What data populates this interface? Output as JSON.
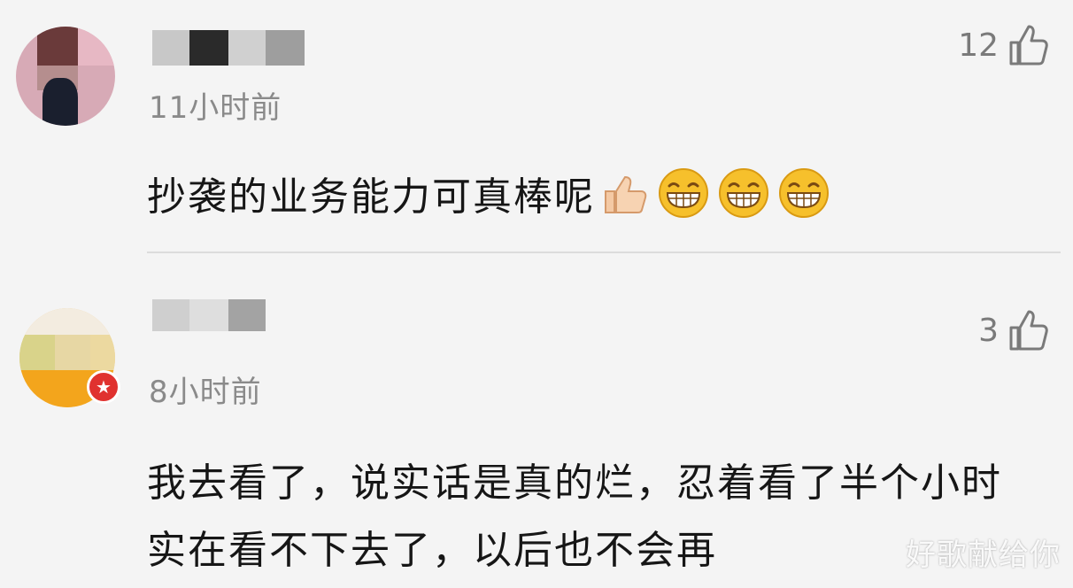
{
  "comments": [
    {
      "time": "11小时前",
      "likes": "12",
      "text": "抄袭的业务能力可真棒呢",
      "emojis": [
        "thumbs-up-icon",
        "grin-icon",
        "grin-icon",
        "grin-icon"
      ]
    },
    {
      "time": "8小时前",
      "likes": "3",
      "text": "我去看了，说实话是真的烂，忍着看了半个小时实在看不下去了，以后也不会再",
      "badge_icon": "star-icon"
    }
  ],
  "watermark": "好歌献给你",
  "colors": {
    "background": "#f4f4f4",
    "text": "#161616",
    "meta": "#8a8a8a",
    "badge": "#e0322f",
    "emoji": "#f6c02c"
  }
}
